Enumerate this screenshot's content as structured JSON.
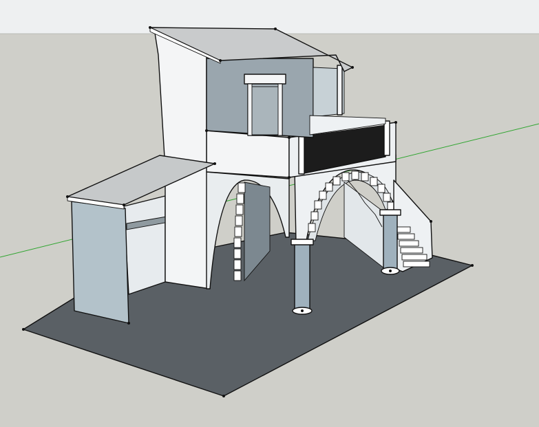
{
  "scene": {
    "sky_color": "#eef0f1",
    "ground_color": "#cfcfc9",
    "axis_green": "#2fa52f",
    "floor_color": "#5a6065",
    "wall_white": "#f4f5f6",
    "wall_shaded": "#9aa6ae",
    "wall_lightblue": "#b9c6cd",
    "roof_color": "#c9cbcc",
    "railing_color": "#1c1c1c",
    "column_color": "#9fb1bd"
  }
}
